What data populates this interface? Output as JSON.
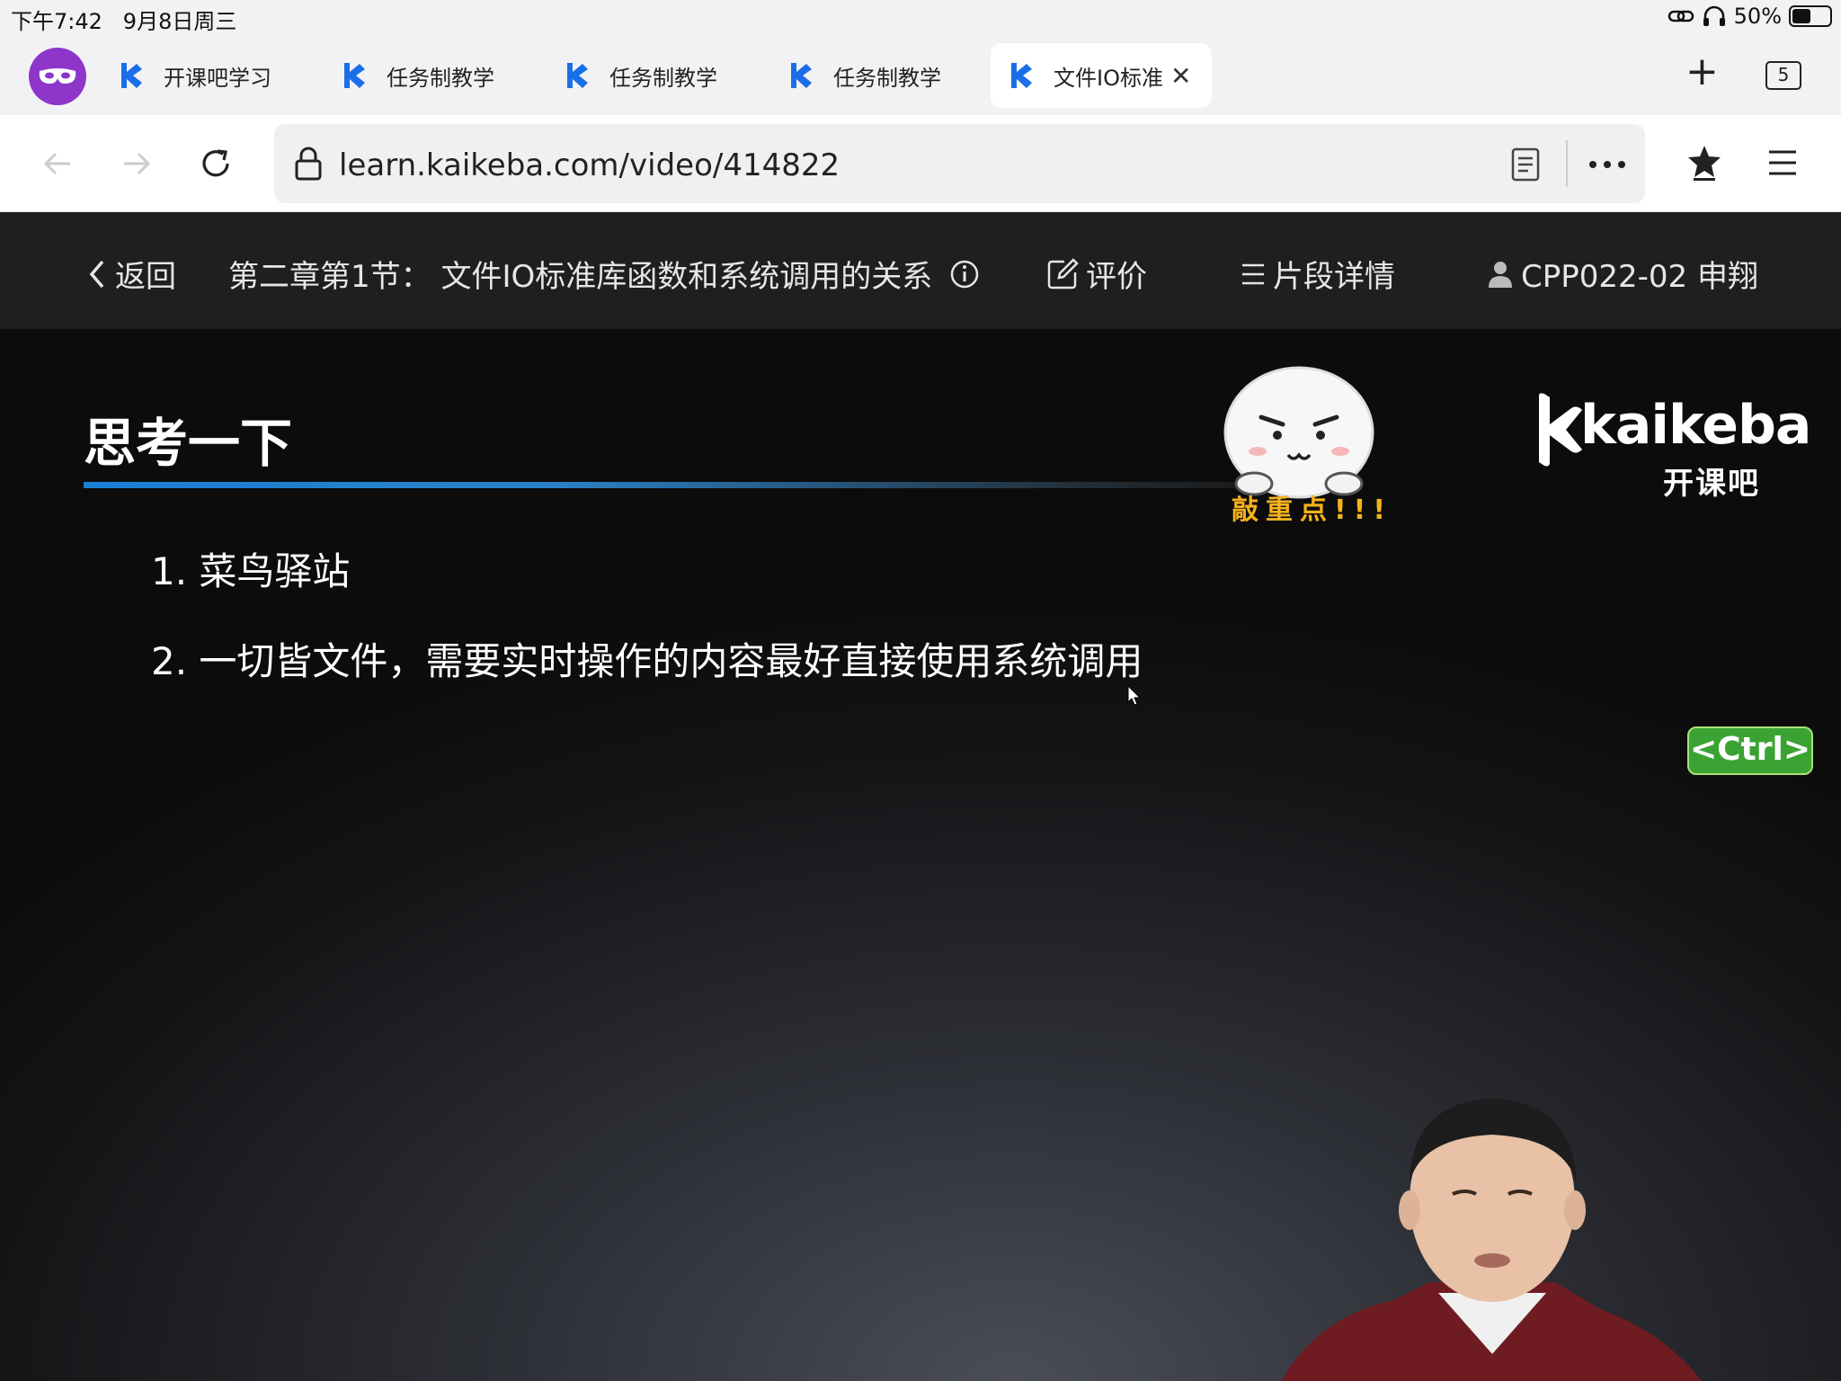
{
  "status": {
    "time": "下午7:42",
    "date": "9月8日周三",
    "battery_text": "50%",
    "battery_level": 0.5
  },
  "tabs": [
    {
      "label": "开课吧学习",
      "active": false
    },
    {
      "label": "任务制教学",
      "active": false
    },
    {
      "label": "任务制教学",
      "active": false
    },
    {
      "label": "任务制教学",
      "active": false
    },
    {
      "label": "文件IO标准",
      "active": true
    }
  ],
  "tab_count": "5",
  "address": {
    "url": "learn.kaikeba.com/video/414822"
  },
  "video_header": {
    "back_label": "返回",
    "lesson_title": "第二章第1节：  文件IO标准库函数和系统调用的关系",
    "review_label": "评价",
    "segments_label": "片段详情",
    "user_label": "CPP022-02 申翔"
  },
  "slide": {
    "title": "思考一下",
    "items": [
      "1. 菜鸟驿站",
      "2. 一切皆文件，需要实时操作的内容最好直接使用系统调用"
    ],
    "sticker_label": "敲重点!!!",
    "logo_text": "kaikeba",
    "logo_sub": "开课吧",
    "ctrl_badge": "<Ctrl>"
  },
  "colors": {
    "browser_bg": "#f2f2f4",
    "video_header_bg": "#1f1f1f",
    "accent_blue": "#1a7fd6",
    "profile_purple": "#8d36c9",
    "sticker_label": "#f5b21c",
    "ctrl_green": "#3ba334"
  }
}
